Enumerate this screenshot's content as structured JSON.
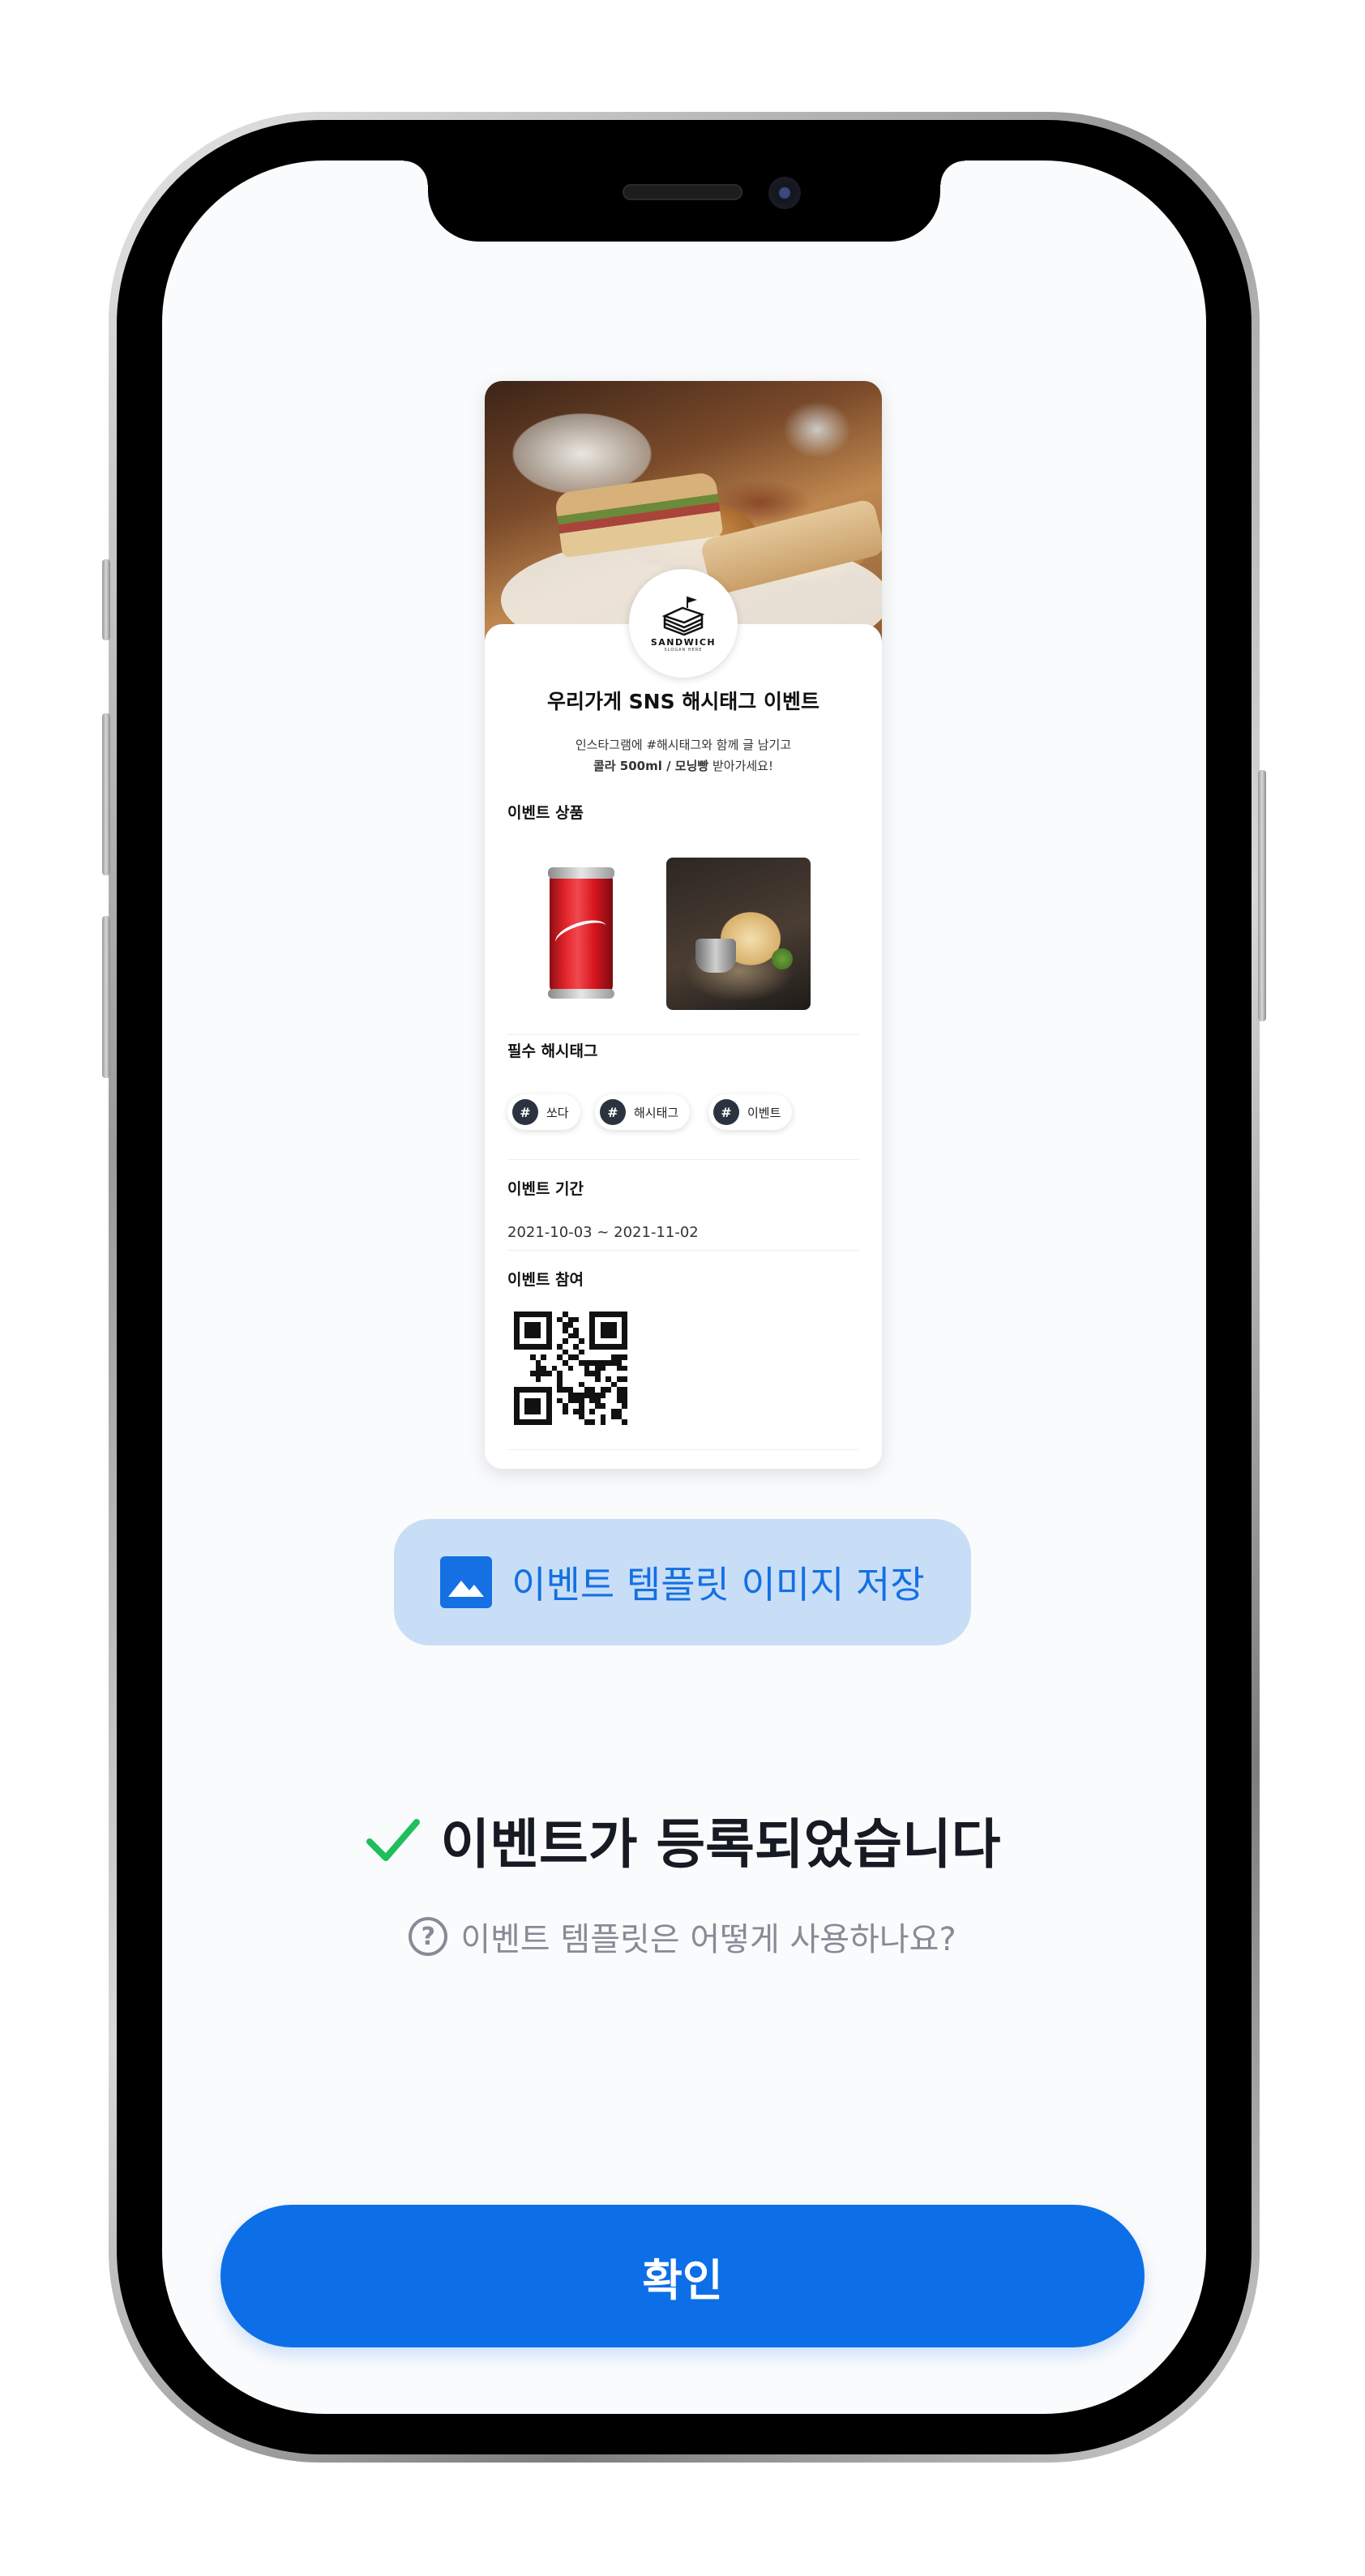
{
  "card": {
    "logo": {
      "name": "SANDWICH",
      "slogan": "SLOGAN HERE"
    },
    "title": "우리가게 SNS 해시태그 이벤트",
    "desc_line1": "인스타그램에 #해시태그와 함께 글 남기고",
    "desc_line2_bold": "콜라 500ml / 모닝빵",
    "desc_line2_rest": " 받아가세요!",
    "products_heading": "이벤트 상품",
    "products": [
      "coca-cola-can",
      "morning-bread"
    ],
    "hashtags_heading": "필수 해시태그",
    "hashtags": [
      "쏘다",
      "해시태그",
      "이벤트"
    ],
    "period_heading": "이벤트 기간",
    "period": "2021-10-03 ~ 2021-11-02",
    "participate_heading": "이벤트 참여"
  },
  "save_button": {
    "label": "이벤트 템플릿 이미지 저장",
    "icon": "image-icon"
  },
  "status": {
    "text": "이벤트가 등록되었습니다",
    "icon": "check-icon",
    "color": "#1fbf5c"
  },
  "help": {
    "text": "이벤트 템플릿은 어떻게 사용하나요?",
    "icon": "question-circle-icon"
  },
  "confirm_button": {
    "label": "확인"
  },
  "colors": {
    "primary": "#0d6fe8",
    "save_button_bg": "#c8def7",
    "tag_icon_bg": "#2b3340",
    "help_text": "#858c96"
  }
}
